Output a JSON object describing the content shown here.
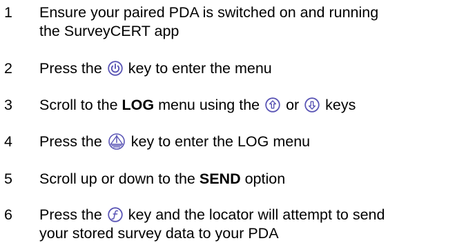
{
  "steps": [
    {
      "number": "1",
      "line1": "Ensure your paired PDA is switched on and running",
      "line2": "the SurveyCERT app"
    },
    {
      "number": "2",
      "before": "Press the",
      "after": "key to enter the menu",
      "icon": "power-icon"
    },
    {
      "number": "3",
      "before": "Scroll to the",
      "bold": "LOG",
      "middle": "menu using the",
      "or": "or",
      "after": "keys",
      "icons": [
        "up-arrow-icon",
        "down-arrow-icon"
      ]
    },
    {
      "number": "4",
      "before": "Press the",
      "after": "key to enter the LOG menu",
      "icon": "antenna-icon"
    },
    {
      "number": "5",
      "before": "Scroll up or down to the",
      "bold": "SEND",
      "after": "option"
    },
    {
      "number": "6",
      "before": "Press the",
      "after": "key and the locator will attempt to send",
      "line2": "your stored survey data to your PDA",
      "icon": "function-icon"
    }
  ],
  "colors": {
    "text": "#000000",
    "icon_accent": "#5a55b5"
  }
}
